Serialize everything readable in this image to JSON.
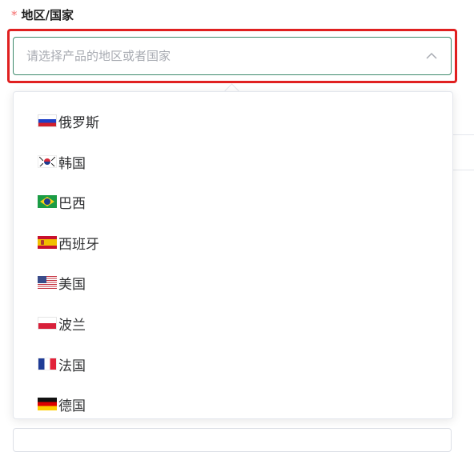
{
  "field": {
    "required_mark": "*",
    "label": "地区/国家",
    "placeholder": "请选择产品的地区或者国家"
  },
  "colors": {
    "accent_border": "#3d8a6c",
    "highlight": "#e02020",
    "required": "#f56c6c"
  },
  "dropdown": {
    "open": true,
    "options": [
      {
        "label": "俄罗斯",
        "flag": "russia-flag-icon"
      },
      {
        "label": "韩国",
        "flag": "south-korea-flag-icon"
      },
      {
        "label": "巴西",
        "flag": "brazil-flag-icon"
      },
      {
        "label": "西班牙",
        "flag": "spain-flag-icon"
      },
      {
        "label": "美国",
        "flag": "usa-flag-icon"
      },
      {
        "label": "波兰",
        "flag": "poland-flag-icon"
      },
      {
        "label": "法国",
        "flag": "france-flag-icon"
      },
      {
        "label": "德国",
        "flag": "germany-flag-icon"
      }
    ]
  }
}
